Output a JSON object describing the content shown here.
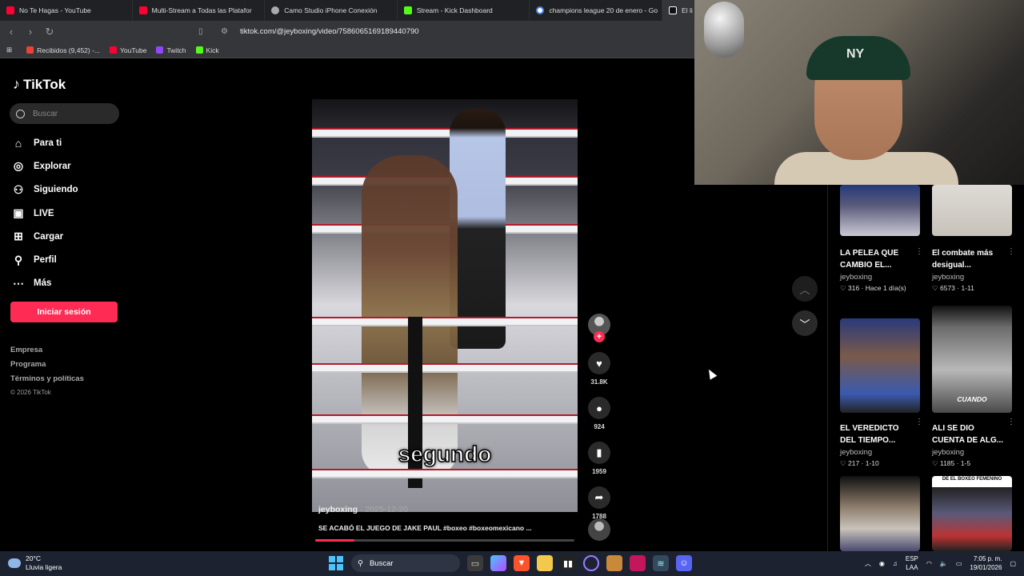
{
  "browser": {
    "tabs": [
      {
        "label": "No Te Hagas - YouTube",
        "icon": "youtube-icon"
      },
      {
        "label": "Multi-Stream a Todas las Platafor",
        "icon": "youtube-icon"
      },
      {
        "label": "Camo Studio iPhone Conexión",
        "icon": "camo-icon"
      },
      {
        "label": "Stream - Kick Dashboard",
        "icon": "kick-icon"
      },
      {
        "label": "champions league 20 de enero - Go",
        "icon": "google-icon"
      },
      {
        "label": "El li",
        "icon": "tiktok-icon"
      }
    ],
    "url": "tiktok.com/@jeyboxing/video/7586065169189440790",
    "bookmarks": [
      {
        "label": "Recibidos (9,452) -..."
      },
      {
        "label": "YouTube"
      },
      {
        "label": "Twitch"
      },
      {
        "label": "Kick"
      }
    ]
  },
  "tiktok": {
    "logo": "TikTok",
    "search_placeholder": "Buscar",
    "nav": [
      {
        "label": "Para ti",
        "icon": "home-icon"
      },
      {
        "label": "Explorar",
        "icon": "compass-icon"
      },
      {
        "label": "Siguiendo",
        "icon": "following-icon"
      },
      {
        "label": "LIVE",
        "icon": "live-icon"
      },
      {
        "label": "Cargar",
        "icon": "upload-icon"
      },
      {
        "label": "Perfil",
        "icon": "profile-icon"
      },
      {
        "label": "Más",
        "icon": "more-icon"
      }
    ],
    "login_label": "Iniciar sesión",
    "footer": {
      "company": "Empresa",
      "program": "Programa",
      "terms": "Términos y políticas",
      "copyright": "© 2026 TikTok"
    },
    "video": {
      "caption_word": "segundo",
      "author": "jeyboxing",
      "date": "· 2025-12-20",
      "description": "SE ACABÓ EL JUEGO DE JAKE PAUL #boxeo #boxeomexicano ...",
      "progress": 0.15,
      "likes": "31.8K",
      "comments": "924",
      "saves": "1959",
      "shares": "1788"
    },
    "related": [
      {
        "title": "LA PELEA QUE CAMBIO EL...",
        "author": "jeyboxing",
        "likes": "316",
        "meta": "Hace 1 día(s)",
        "overlay": ""
      },
      {
        "title": "El combate más desigual...",
        "author": "jeyboxing",
        "likes": "6573",
        "meta": "1-11",
        "overlay": ""
      },
      {
        "title": "EL VEREDICTO DEL TIEMPO...",
        "author": "jeyboxing",
        "likes": "217",
        "meta": "1-10",
        "overlay": ""
      },
      {
        "title": "ALI SE DIO CUENTA DE ALG...",
        "author": "jeyboxing",
        "likes": "1185",
        "meta": "1-5",
        "overlay": "CUANDO"
      },
      {
        "title": "",
        "author": "",
        "likes": "",
        "meta": "",
        "overlay": ""
      },
      {
        "title": "",
        "author": "",
        "likes": "",
        "meta": "",
        "overlay": "DE EL BOXEO FEMENINO"
      }
    ]
  },
  "taskbar": {
    "weather_temp": "20°C",
    "weather_desc": "Lluvia ligera",
    "search_label": "Buscar",
    "lang_top": "ESP",
    "lang_bottom": "LAA",
    "time": "7:05 p. m.",
    "date": "19/01/2026"
  },
  "colors": {
    "accent": "#fe2c55",
    "background": "#000000",
    "taskbar": "#1c2230"
  }
}
